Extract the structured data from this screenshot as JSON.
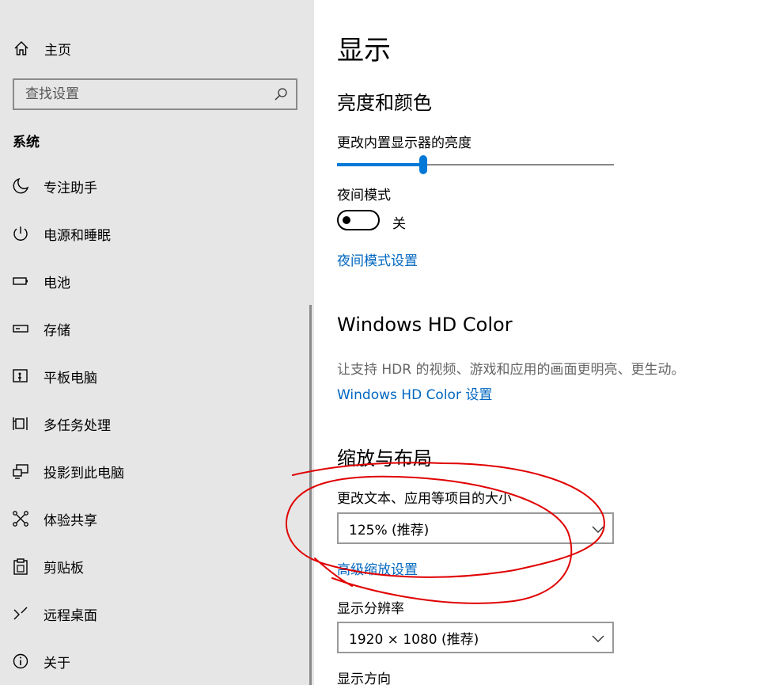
{
  "sidebar": {
    "home_label": "主页",
    "search_placeholder": "查找设置",
    "section_title": "系统",
    "items": [
      {
        "label": "专注助手",
        "icon": "moon-icon"
      },
      {
        "label": "电源和睡眠",
        "icon": "power-icon"
      },
      {
        "label": "电池",
        "icon": "battery-icon"
      },
      {
        "label": "存储",
        "icon": "storage-icon"
      },
      {
        "label": "平板电脑",
        "icon": "tablet-icon"
      },
      {
        "label": "多任务处理",
        "icon": "multitask-icon"
      },
      {
        "label": "投影到此电脑",
        "icon": "project-icon"
      },
      {
        "label": "体验共享",
        "icon": "share-icon"
      },
      {
        "label": "剪贴板",
        "icon": "clipboard-icon"
      },
      {
        "label": "远程桌面",
        "icon": "remote-desktop-icon"
      },
      {
        "label": "关于",
        "icon": "info-icon"
      }
    ]
  },
  "main": {
    "title": "显示",
    "brightness": {
      "heading": "亮度和颜色",
      "slider_label": "更改内置显示器的亮度",
      "value_fraction": 0.31
    },
    "night_light": {
      "label": "夜间模式",
      "state_text": "关",
      "settings_link": "夜间模式设置"
    },
    "hd_color": {
      "heading": "Windows HD Color",
      "description": "让支持 HDR 的视频、游戏和应用的画面更明亮、更生动。",
      "link": "Windows HD Color 设置"
    },
    "scale_layout": {
      "heading": "缩放与布局",
      "scale_label": "更改文本、应用等项目的大小",
      "scale_value": "125% (推荐)",
      "advanced_link": "高级缩放设置",
      "resolution_label": "显示分辨率",
      "resolution_value": "1920 × 1080 (推荐)",
      "orientation_label": "显示方向"
    }
  },
  "colors": {
    "accent": "#0078d7",
    "link": "#0067c0",
    "annotation": "#e00000"
  }
}
